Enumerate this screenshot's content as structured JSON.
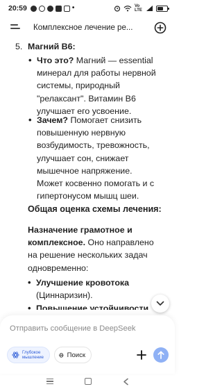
{
  "status_bar": {
    "time": "20:59",
    "network": "Vo LTE",
    "battery_level": 0.6,
    "icons": [
      "messenger-icon",
      "whatsapp-icon",
      "telegram-icon",
      "notification-icon",
      "gallery-icon",
      "alarm-icon",
      "wifi-icon",
      "signal-icon",
      "battery-icon"
    ]
  },
  "header": {
    "title": "Комплексное лечение ре...",
    "menu_icon": "hamburger-icon",
    "new_chat_icon": "plus-circle-icon"
  },
  "message": {
    "item_number": "5.",
    "item_title": "Магний B6:",
    "bullets": [
      {
        "label": "Что это?",
        "lines": [
          "Магний — essential",
          "минерал для работы нервной",
          "системы, природный",
          "\"релаксант\". Витамин B6",
          "улучшает его усвоение."
        ]
      },
      {
        "label": "Зачем?",
        "lines": [
          "Помогает снизить",
          "повышенную нервную",
          "возбудимость, тревожность,",
          "улучшает сон, снижает",
          "мышечное напряжение.",
          "Может косвенно помогать и с",
          "гипертонусом мышц шеи."
        ]
      }
    ],
    "section_heading": "Общая оценка схемы лечения:",
    "paragraph_bold": "Назначение грамотное и комплексное.",
    "paragraph_bold_lines": [
      "Назначение грамотное и",
      "комплексное."
    ],
    "paragraph_rest_lines": [
      "Оно направлено",
      "на решение нескольких задач",
      "одновременно:"
    ],
    "list2": [
      {
        "label": "Улучшение кровотока",
        "rest": "(Циннаризин)."
      },
      {
        "label": "Повышение устойчивости",
        "rest": ""
      }
    ]
  },
  "composer": {
    "placeholder": "Отправить сообщение в DeepSeek",
    "deep_think_label_1": "Глубокое",
    "deep_think_label_2": "мышление",
    "search_label": "Поиск"
  },
  "colors": {
    "accent": "#2c5bd6",
    "send_disabled": "#8fb1f5",
    "chip_active_bg": "#eef3ff"
  }
}
